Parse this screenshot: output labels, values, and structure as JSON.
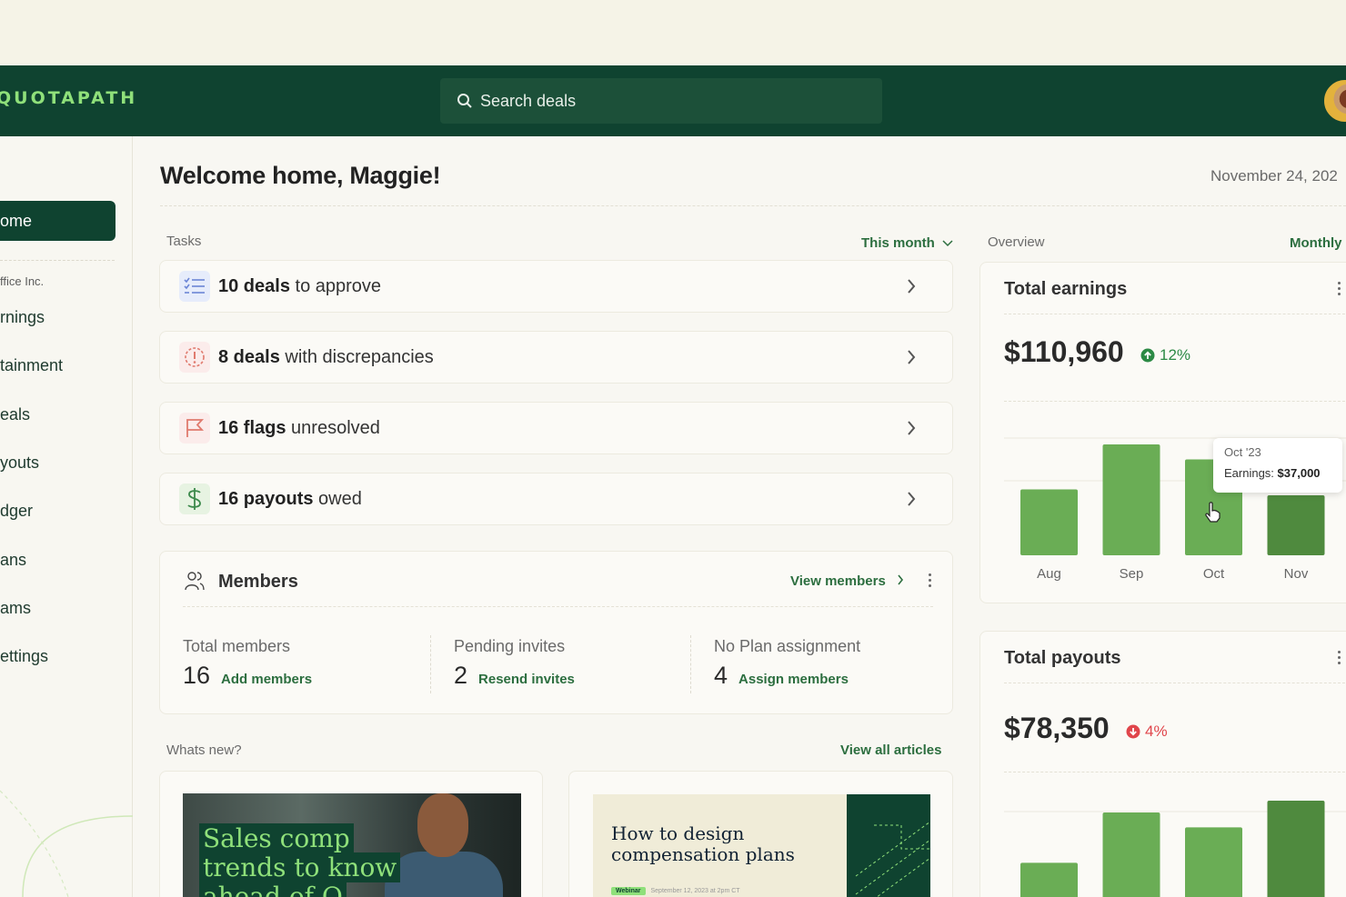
{
  "brand": {
    "logo": "QUOTAPATH"
  },
  "search": {
    "placeholder": "Search deals"
  },
  "sidebar": {
    "active": "ome",
    "company": "ffice Inc.",
    "items": [
      {
        "label": "rnings"
      },
      {
        "label": "tainment"
      },
      {
        "label": "eals"
      },
      {
        "label": "youts"
      },
      {
        "label": "dger"
      },
      {
        "label": "ans"
      },
      {
        "label": "ams"
      },
      {
        "label": "ettings"
      }
    ]
  },
  "header": {
    "welcome": "Welcome home, Maggie!",
    "date": "November 24, 202"
  },
  "tasks": {
    "label": "Tasks",
    "filter": "This month",
    "items": [
      {
        "count": "10 deals",
        "rest": " to approve",
        "icon": "list-check-icon"
      },
      {
        "count": "8 deals",
        "rest": " with discrepancies",
        "icon": "alert-icon"
      },
      {
        "count": "16 flags",
        "rest": " unresolved",
        "icon": "flag-icon"
      },
      {
        "count": "16 payouts",
        "rest": " owed",
        "icon": "dollar-icon"
      }
    ]
  },
  "members": {
    "title": "Members",
    "view_link": "View members",
    "stats": [
      {
        "label": "Total members",
        "value": "16",
        "action": "Add members"
      },
      {
        "label": "Pending invites",
        "value": "2",
        "action": "Resend invites"
      },
      {
        "label": "No Plan assignment",
        "value": "4",
        "action": "Assign members"
      }
    ]
  },
  "whats_new": {
    "label": "Whats new?",
    "view_all": "View all articles",
    "articles": [
      {
        "title_lines": [
          "Sales comp",
          "trends to know",
          "ahead of Q"
        ]
      },
      {
        "title_lines": [
          "How to design",
          "compensation plans"
        ],
        "tag": "Webinar",
        "meta": "September 12, 2023 at 2pm CT"
      }
    ]
  },
  "overview": {
    "label": "Overview",
    "filter": "Monthly",
    "earnings": {
      "title": "Total earnings",
      "value": "$110,960",
      "change": "12%",
      "change_color": "#2c8a45",
      "tooltip_month": "Oct '23",
      "tooltip_label": "Earnings: ",
      "tooltip_value": "$37,000"
    },
    "payouts": {
      "title": "Total payouts",
      "value": "$78,350",
      "change": "4%",
      "change_color": "#e0454b"
    }
  },
  "chart_data": [
    {
      "type": "bar",
      "title": "Total earnings",
      "categories": [
        "Aug",
        "Sep",
        "Oct",
        "Nov"
      ],
      "values": [
        22000,
        37000,
        32000,
        20000
      ],
      "highlight": "Nov",
      "colors": {
        "bar": "#6aad55",
        "highlight": "#4f8a3e"
      }
    },
    {
      "type": "bar",
      "title": "Total payouts",
      "categories": [
        "Aug",
        "Sep",
        "Oct",
        "Nov"
      ],
      "values": [
        14000,
        31000,
        26000,
        35000
      ],
      "highlight": "Nov",
      "colors": {
        "bar": "#6aad55",
        "highlight": "#4f8a3e"
      }
    }
  ]
}
